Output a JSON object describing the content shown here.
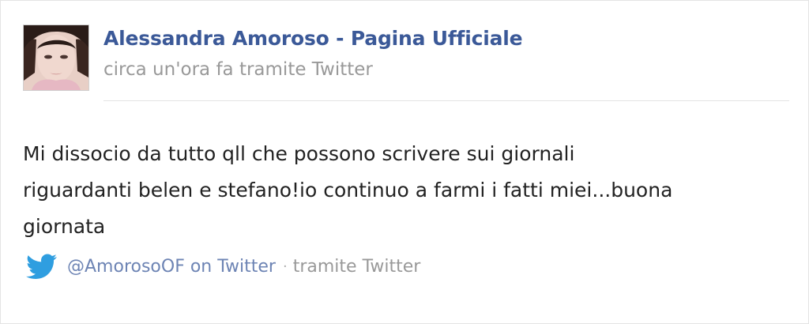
{
  "post": {
    "author": "Alessandra Amoroso - Pagina Ufficiale",
    "meta": "circa un'ora fa tramite Twitter",
    "text": "Mi dissocio da tutto qll che possono scrivere sui giornali\nriguardanti belen e stefano!io continuo a farmi i fatti miei...buona\ngiornata"
  },
  "footer": {
    "handle_link": "@AmorosoOF on Twitter",
    "separator": "·",
    "via": "tramite Twitter",
    "icon": "twitter-bird-icon"
  },
  "colors": {
    "link": "#3b5998",
    "muted": "#999999",
    "twitter_blue": "#2f9ee0"
  }
}
